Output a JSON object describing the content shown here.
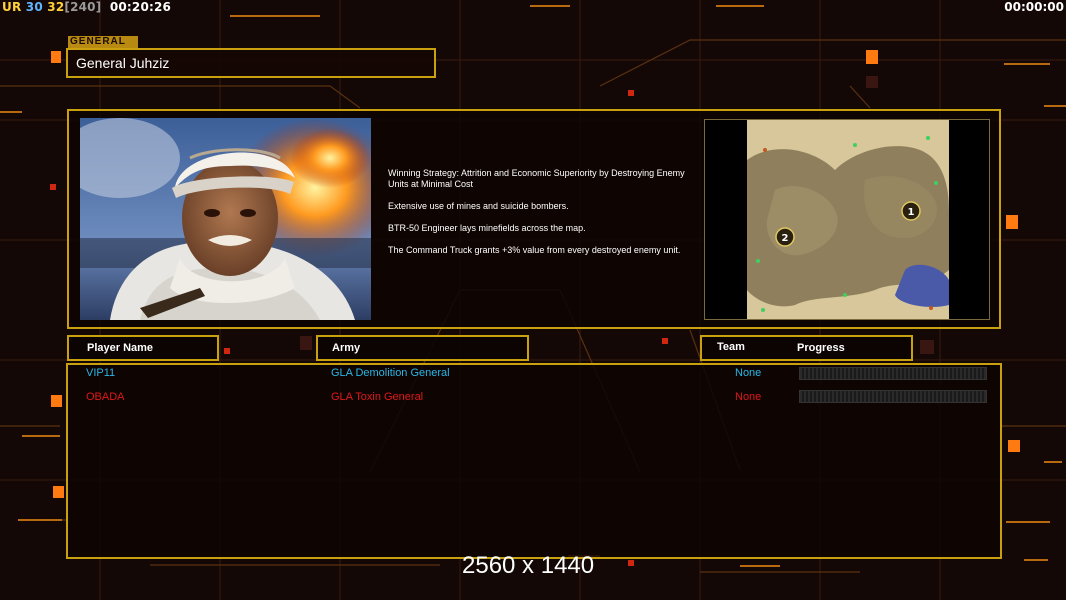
{
  "hud": {
    "ur": "UR",
    "fps_a": "30",
    "fps_b": "32",
    "fps_cap": "[240]",
    "clock": "00:20:26",
    "timer": "00:00:00"
  },
  "general": {
    "section_label": "GENERAL",
    "name": "General Juhziz",
    "strategy": [
      "Winning Strategy: Attrition and Economic Superiority by Destroying Enemy Units at Minimal Cost",
      "Extensive use of mines and suicide bombers.",
      "BTR-50 Engineer lays minefields across the map.",
      "The Command Truck grants +3% value from every destroyed enemy unit."
    ]
  },
  "map": {
    "start_positions": [
      "1",
      "2"
    ]
  },
  "table": {
    "headers": {
      "player_name": "Player Name",
      "army": "Army",
      "team": "Team",
      "progress": "Progress"
    },
    "players": [
      {
        "name": "VIP11",
        "army": "GLA Demolition General",
        "team": "None",
        "progress": 0,
        "color": "#2ab6e6"
      },
      {
        "name": "OBADA",
        "army": "GLA Toxin General",
        "team": "None",
        "progress": 0,
        "color": "#e01818"
      }
    ]
  },
  "watermark": "2560 x 1440",
  "colors": {
    "frame": "#c9a10f",
    "background": "#140806",
    "accent_orange": "#ff7a10"
  }
}
